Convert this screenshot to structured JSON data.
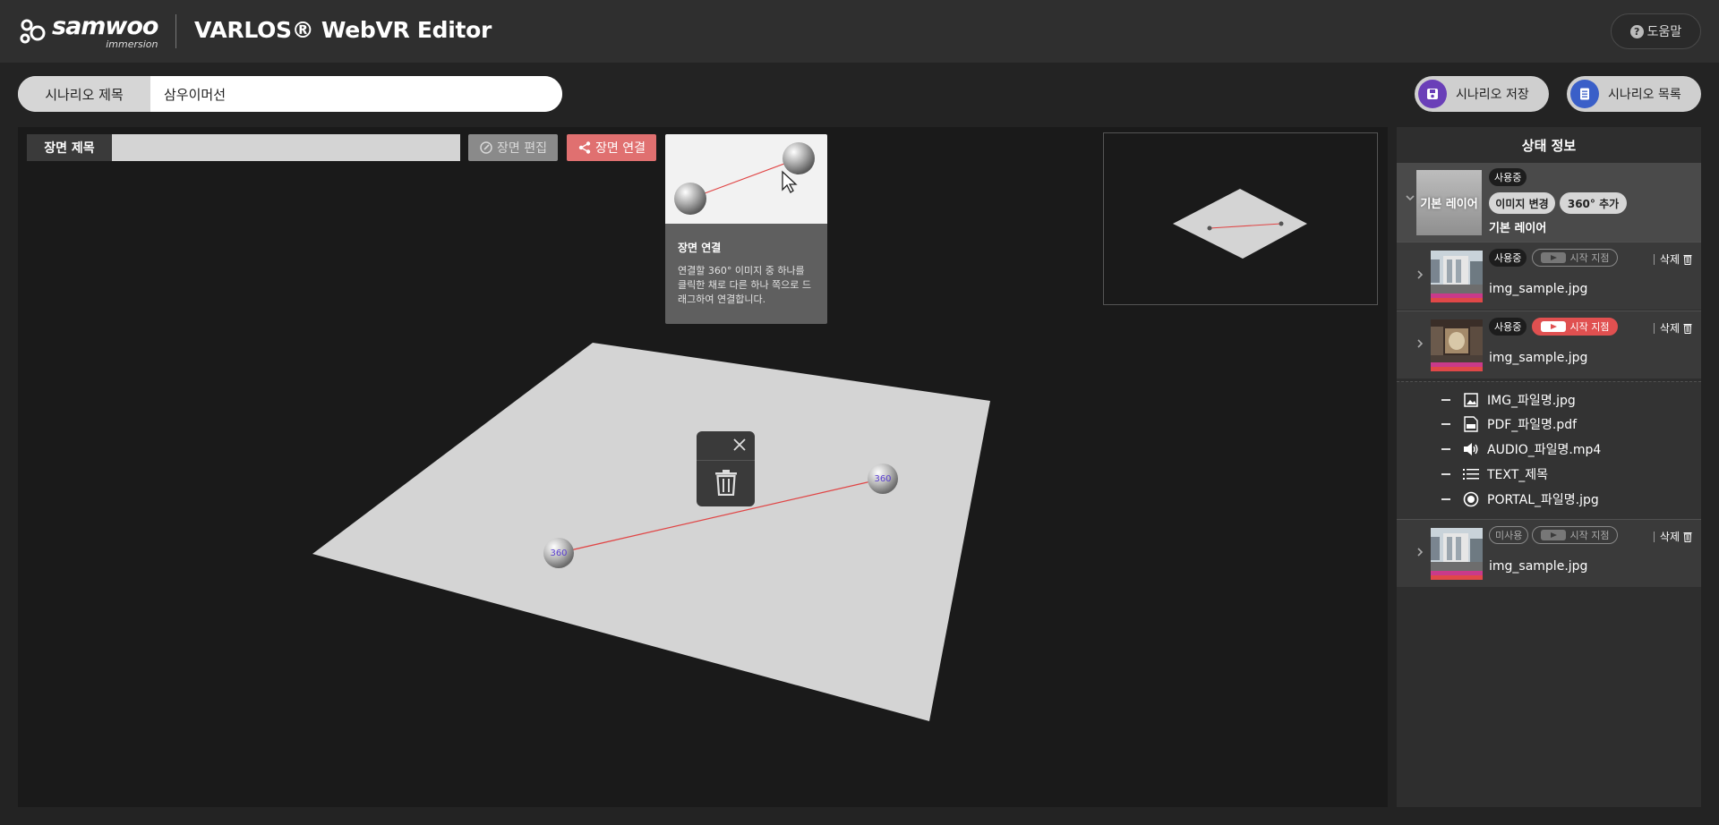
{
  "header": {
    "logo_name": "samwoo",
    "logo_sub": "immersion",
    "app_title": "VARLOS® WebVR Editor",
    "help_label": "도움말"
  },
  "scenario": {
    "title_label": "시나리오 제목",
    "title_value": "삼우이머선",
    "save_label": "시나리오 저장",
    "list_label": "시나리오 목록"
  },
  "editor": {
    "scene_title_label": "장면 제목",
    "scene_title_value": "",
    "edit_label": "장면 편집",
    "link_label": "장면 연결",
    "node_label": "360",
    "tooltip": {
      "title": "장면 연결",
      "text": "연결할 360° 이미지 중 하나를 클릭한 채로 다른 하나 쪽으로 드래그하여 연결합니다."
    }
  },
  "panel": {
    "title": "상태 정보",
    "base_layer": {
      "thumb_label": "기본 레이어",
      "status": "사용중",
      "change_image": "이미지 변경",
      "add_360": "360° 추가",
      "name": "기본 레이어"
    },
    "scenes": [
      {
        "status": "사용중",
        "start_label": "시작 지점",
        "start_active": false,
        "delete_label": "삭제",
        "file": "img_sample.jpg",
        "used": true
      },
      {
        "status": "사용중",
        "start_label": "시작 지점",
        "start_active": true,
        "delete_label": "삭제",
        "file": "img_sample.jpg",
        "used": true
      },
      {
        "status": "미사용",
        "start_label": "시작 지점",
        "start_active": false,
        "delete_label": "삭제",
        "file": "img_sample.jpg",
        "used": false
      }
    ],
    "items": [
      {
        "icon": "image-icon",
        "label": "IMG_파일명.jpg"
      },
      {
        "icon": "pdf-icon",
        "label": "PDF_파일명.pdf"
      },
      {
        "icon": "speaker-icon",
        "label": "AUDIO_파일명.mp4"
      },
      {
        "icon": "list-icon",
        "label": "TEXT_제목"
      },
      {
        "icon": "portal-icon",
        "label": "PORTAL_파일명.jpg"
      }
    ]
  },
  "colors": {
    "accent_link": "#e07070",
    "start_active": "#e05050",
    "connection_line": "#e04545"
  }
}
